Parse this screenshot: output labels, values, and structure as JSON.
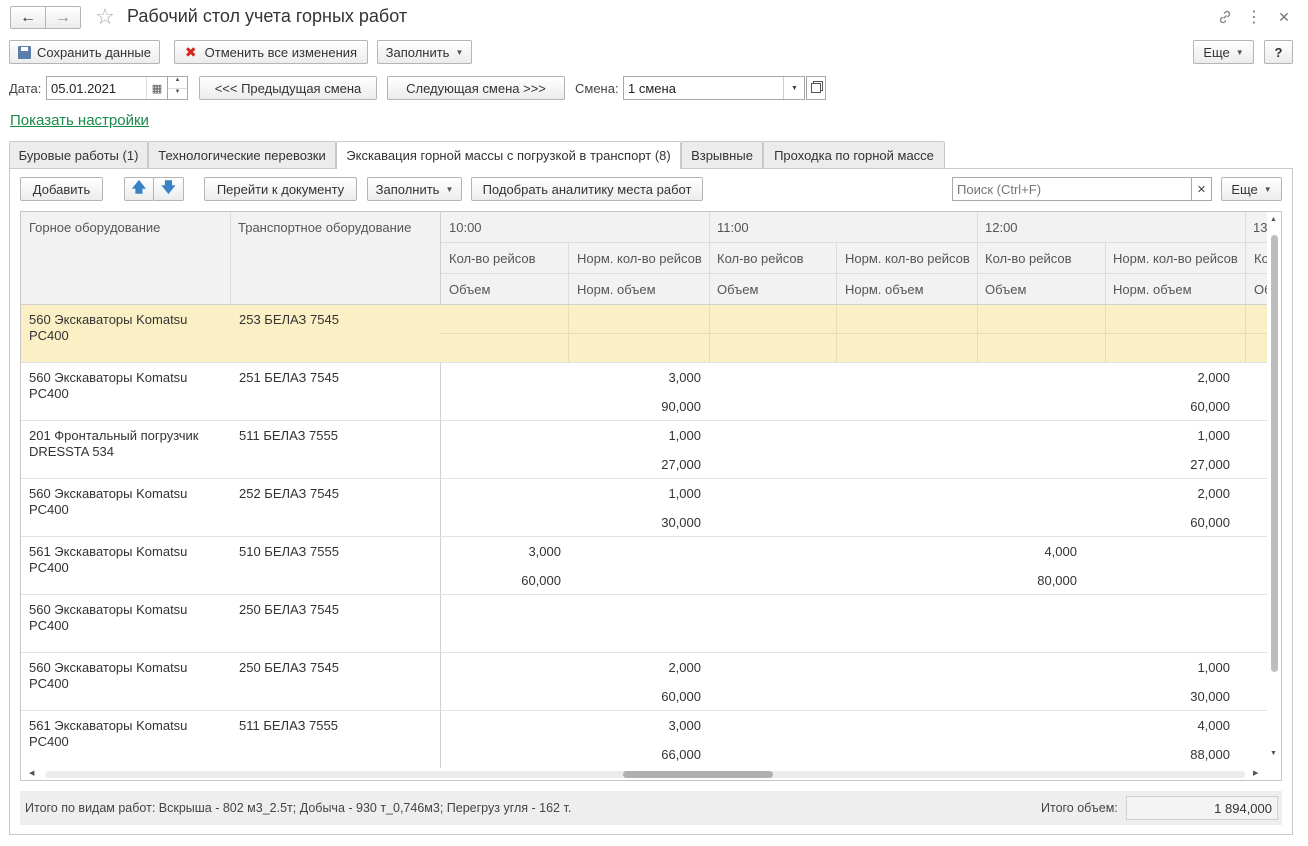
{
  "window": {
    "title": "Рабочий стол учета горных работ",
    "back_icon": "arrow-left-icon",
    "forward_icon": "arrow-right-icon",
    "favorite_icon": "star-icon",
    "link_icon": "link-icon",
    "menu_icon": "kebab-icon",
    "close_icon": "close-icon"
  },
  "toolbar": {
    "save_label": "Сохранить данные",
    "cancel_label": "Отменить все изменения",
    "fill_label": "Заполнить",
    "more_label": "Еще",
    "help_label": "?"
  },
  "shift_bar": {
    "date_label": "Дата:",
    "date_value": "05.01.2021",
    "prev_label": "<<< Предыдущая смена",
    "next_label": "Следующая смена >>>",
    "shift_label": "Смена:",
    "shift_value": "1 смена"
  },
  "settings_link": "Показать настройки",
  "tabs": [
    {
      "label": "Буровые работы (1)"
    },
    {
      "label": "Технологические перевозки"
    },
    {
      "label": "Экскавация горной массы с погрузкой в транспорт (8)"
    },
    {
      "label": "Взрывные"
    },
    {
      "label": "Проходка по горной массе"
    }
  ],
  "grid_toolbar": {
    "add_label": "Добавить",
    "goto_label": "Перейти к документу",
    "fill_label": "Заполнить",
    "pick_label": "Подобрать аналитику места работ",
    "search_placeholder": "Поиск (Ctrl+F)",
    "more_label": "Еще"
  },
  "grid": {
    "col_equipment": "Горное оборудование",
    "col_transport": "Транспортное оборудование",
    "hours": [
      "10:00",
      "11:00",
      "12:00",
      "13"
    ],
    "sub_trips": "Кол-во рейсов",
    "sub_norm_trips": "Норм. кол-во рейсов",
    "sub_volume": "Объем",
    "sub_norm_volume": "Норм. объем",
    "sub_trips_cut": "Ко",
    "sub_volume_cut": "Об",
    "rows": [
      {
        "eq1": "560 Экскаваторы Komatsu",
        "eq2": "PC400",
        "transport": "253 БЕЛАЗ 7545",
        "c10t": "",
        "c10n": "",
        "c10v": "",
        "c10nv": "",
        "c11t": "",
        "c11n": "",
        "c11v": "",
        "c11nv": "",
        "c12t": "",
        "c12n": "",
        "c12v": "",
        "c12nv": ""
      },
      {
        "eq1": "560 Экскаваторы Komatsu",
        "eq2": "PC400",
        "transport": "251 БЕЛАЗ 7545",
        "c10t": "",
        "c10n": "3,000",
        "c10v": "",
        "c10nv": "90,000",
        "c11t": "",
        "c11n": "",
        "c11v": "",
        "c11nv": "",
        "c12t": "",
        "c12n": "2,000",
        "c12v": "",
        "c12nv": "60,000"
      },
      {
        "eq1": "201 Фронтальный погрузчик",
        "eq2": "DRESSTA 534",
        "transport": "511 БЕЛАЗ 7555",
        "c10t": "",
        "c10n": "1,000",
        "c10v": "",
        "c10nv": "27,000",
        "c11t": "",
        "c11n": "",
        "c11v": "",
        "c11nv": "",
        "c12t": "",
        "c12n": "1,000",
        "c12v": "",
        "c12nv": "27,000"
      },
      {
        "eq1": "560 Экскаваторы Komatsu",
        "eq2": "PC400",
        "transport": "252 БЕЛАЗ 7545",
        "c10t": "",
        "c10n": "1,000",
        "c10v": "",
        "c10nv": "30,000",
        "c11t": "",
        "c11n": "",
        "c11v": "",
        "c11nv": "",
        "c12t": "",
        "c12n": "2,000",
        "c12v": "",
        "c12nv": "60,000"
      },
      {
        "eq1": "561 Экскаваторы Komatsu",
        "eq2": "PC400",
        "transport": "510 БЕЛАЗ 7555",
        "c10t": "3,000",
        "c10n": "",
        "c10v": "60,000",
        "c10nv": "",
        "c11t": "",
        "c11n": "4,000",
        "c11v": "",
        "c11nv": "80,000",
        "c12t": "",
        "c12n": "",
        "c12v": "",
        "c12nv": ""
      },
      {
        "eq1": "560 Экскаваторы Komatsu",
        "eq2": "PC400",
        "transport": "250 БЕЛАЗ 7545",
        "c10t": "",
        "c10n": "",
        "c10v": "",
        "c10nv": "",
        "c11t": "",
        "c11n": "",
        "c11v": "",
        "c11nv": "",
        "c12t": "",
        "c12n": "",
        "c12v": "",
        "c12nv": ""
      },
      {
        "eq1": "560 Экскаваторы Komatsu",
        "eq2": "PC400",
        "transport": "250 БЕЛАЗ 7545",
        "c10t": "",
        "c10n": "2,000",
        "c10v": "",
        "c10nv": "60,000",
        "c11t": "",
        "c11n": "",
        "c11v": "",
        "c11nv": "",
        "c12t": "",
        "c12n": "1,000",
        "c12v": "",
        "c12nv": "30,000"
      },
      {
        "eq1": "561 Экскаваторы Komatsu",
        "eq2": "PC400",
        "transport": "511 БЕЛАЗ 7555",
        "c10t": "",
        "c10n": "3,000",
        "c10v": "",
        "c10nv": "66,000",
        "c11t": "",
        "c11n": "",
        "c11v": "",
        "c11nv": "",
        "c12t": "",
        "c12n": "4,000",
        "c12v": "",
        "c12nv": "88,000"
      }
    ]
  },
  "footer": {
    "summary": "Итого по видам работ: Вскрыша - 802 м3_2.5т; Добыча - 930 т_0,746м3; Перегруз угля - 162 т.",
    "total_label": "Итого объем:",
    "total_value": "1 894,000"
  },
  "colors": {
    "selected_row": "#fbf0c5",
    "link": "#1a8a4a",
    "cancel_icon": "#d8261e",
    "arrow_icon": "#3b82c4"
  }
}
